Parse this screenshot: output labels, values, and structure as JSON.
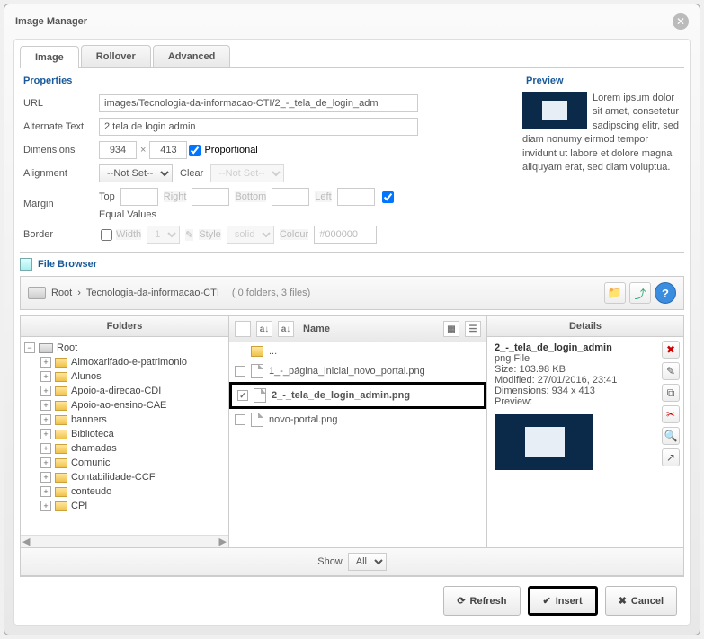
{
  "dialog": {
    "title": "Image Manager"
  },
  "tabs": {
    "image": "Image",
    "rollover": "Rollover",
    "advanced": "Advanced"
  },
  "section": {
    "properties": "Properties",
    "preview": "Preview",
    "filebrowser": "File Browser"
  },
  "labels": {
    "url": "URL",
    "alt": "Alternate Text",
    "dimensions": "Dimensions",
    "proportional": "Proportional",
    "alignment": "Alignment",
    "clear": "Clear",
    "margin": "Margin",
    "top": "Top",
    "right": "Right",
    "bottom": "Bottom",
    "left": "Left",
    "equal": "Equal Values",
    "border": "Border",
    "width": "Width",
    "style": "Style",
    "colour": "Colour"
  },
  "values": {
    "url": "images/Tecnologia-da-informacao-CTI/2_-_tela_de_login_adm",
    "alt": "2 tela de login admin",
    "dim_w": "934",
    "dim_h": "413",
    "align": "--Not Set--",
    "clear": "--Not Set--",
    "border_width": "1",
    "border_style": "solid",
    "border_colour": "#000000"
  },
  "preview_text": "Lorem ipsum dolor sit amet, consetetur sadipscing elitr, sed diam nonumy eirmod tempor invidunt ut labore et dolore magna aliquyam erat, sed diam voluptua.",
  "crumbs": {
    "root": "Root",
    "folder": "Tecnologia-da-informacao-CTI",
    "count": "( 0 folders, 3 files)"
  },
  "columns": {
    "folders": "Folders",
    "name": "Name",
    "details": "Details"
  },
  "tree": {
    "root": "Root",
    "items": [
      "Almoxarifado-e-patrimonio",
      "Alunos",
      "Apoio-a-direcao-CDI",
      "Apoio-ao-ensino-CAE",
      "banners",
      "Biblioteca",
      "chamadas",
      "Comunic",
      "Contabilidade-CCF",
      "conteudo",
      "CPI"
    ]
  },
  "files": {
    "up": "...",
    "items": [
      "1_-_página_inicial_novo_portal.png",
      "2_-_tela_de_login_admin.png",
      "novo-portal.png"
    ]
  },
  "details": {
    "name": "2_-_tela_de_login_admin",
    "type": "png File",
    "size_label": "Size:",
    "size": "103.98 KB",
    "modified_label": "Modified:",
    "modified": "27/01/2016, 23:41",
    "dim_label": "Dimensions:",
    "dim": "934 x 413",
    "preview_label": "Preview:"
  },
  "showbar": {
    "show": "Show",
    "all": "All"
  },
  "footer": {
    "refresh": "Refresh",
    "insert": "Insert",
    "cancel": "Cancel"
  }
}
